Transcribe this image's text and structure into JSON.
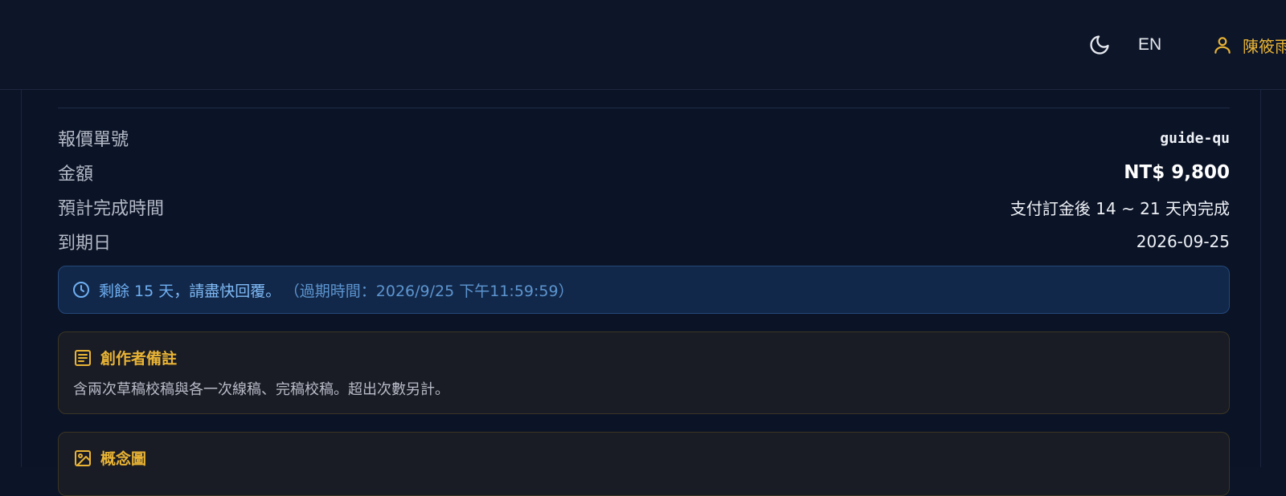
{
  "header": {
    "theme_icon": "moon-icon",
    "lang_label": "EN",
    "user_icon": "user-icon",
    "user_name": "陳筱雨"
  },
  "quote": {
    "rows": [
      {
        "label": "報價單號",
        "value": "guide-qu"
      },
      {
        "label": "金額",
        "value": "NT$ 9,800"
      },
      {
        "label": "預計完成時間",
        "value": "支付訂金後 14 ~ 21 天內完成"
      },
      {
        "label": "到期日",
        "value": "2026-09-25"
      }
    ]
  },
  "alert": {
    "icon": "clock-icon",
    "remaining": "剩餘 15 天",
    "message": "，請盡快回覆。",
    "expiry": "（過期時間：2026/9/25 下午11:59:59）"
  },
  "creator_note": {
    "icon": "note-icon",
    "title": "創作者備註",
    "body": "含兩次草稿校稿與各一次線稿、完稿校稿。超出次數另計。"
  },
  "concept": {
    "icon": "image-icon",
    "title": "概念圖"
  },
  "colors": {
    "background": "#0c1427",
    "accent_gold": "#e9b435",
    "alert_blue": "#6fb0f3"
  }
}
